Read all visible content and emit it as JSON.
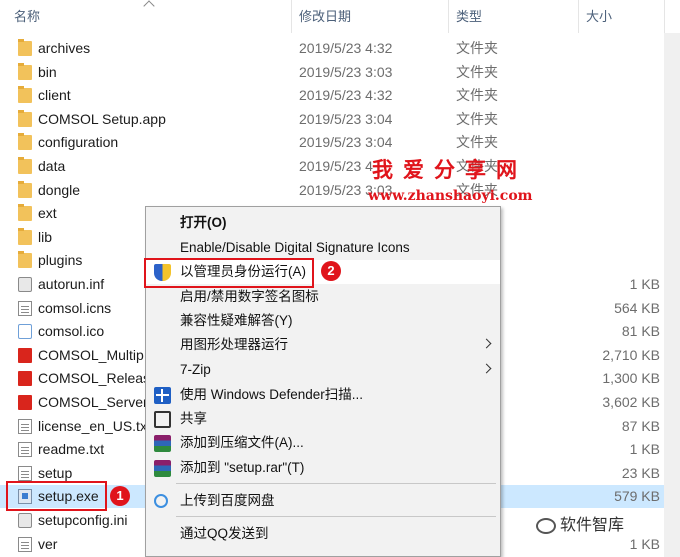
{
  "header": {
    "name": "名称",
    "date": "修改日期",
    "type": "类型",
    "size": "大小"
  },
  "files": [
    {
      "name": "archives",
      "date": "2019/5/23 4:32",
      "type": "文件夹",
      "size": "",
      "icon": "folder-icon"
    },
    {
      "name": "bin",
      "date": "2019/5/23 3:03",
      "type": "文件夹",
      "size": "",
      "icon": "folder-icon"
    },
    {
      "name": "client",
      "date": "2019/5/23 4:32",
      "type": "文件夹",
      "size": "",
      "icon": "folder-icon"
    },
    {
      "name": "COMSOL Setup.app",
      "date": "2019/5/23 3:04",
      "type": "文件夹",
      "size": "",
      "icon": "folder-icon"
    },
    {
      "name": "configuration",
      "date": "2019/5/23 3:04",
      "type": "文件夹",
      "size": "",
      "icon": "folder-icon"
    },
    {
      "name": "data",
      "date": "2019/5/23 4",
      "type": "文件夹",
      "size": "",
      "icon": "folder-icon"
    },
    {
      "name": "dongle",
      "date": "2019/5/23 3:03",
      "type": "文件夹",
      "size": "",
      "icon": "folder-icon"
    },
    {
      "name": "ext",
      "date": "",
      "type": "",
      "size": "",
      "icon": "folder-icon"
    },
    {
      "name": "lib",
      "date": "",
      "type": "",
      "size": "",
      "icon": "folder-icon"
    },
    {
      "name": "plugins",
      "date": "",
      "type": "",
      "size": "",
      "icon": "folder-icon"
    },
    {
      "name": "autorun.inf",
      "date": "",
      "type": "息",
      "size": "1 KB",
      "icon": "settings-file-icon"
    },
    {
      "name": "comsol.icns",
      "date": "",
      "type": "件",
      "size": "564 KB",
      "icon": "document-icon"
    },
    {
      "name": "comsol.ico",
      "date": "",
      "type": "",
      "size": "81 KB",
      "icon": "ico-file-icon"
    },
    {
      "name": "COMSOL_Multip",
      "date": "",
      "type": "件",
      "size": "2,710 KB",
      "icon": "pdf-icon"
    },
    {
      "name": "COMSOL_Releas",
      "date": "",
      "type": "件",
      "size": "1,300 KB",
      "icon": "pdf-icon"
    },
    {
      "name": "COMSOL_Server",
      "date": "",
      "type": "件",
      "size": "3,602 KB",
      "icon": "pdf-icon"
    },
    {
      "name": "license_en_US.tx",
      "date": "",
      "type": "",
      "size": "87 KB",
      "icon": "document-icon"
    },
    {
      "name": "readme.txt",
      "date": "",
      "type": "档",
      "size": "1 KB",
      "icon": "document-icon"
    },
    {
      "name": "setup",
      "date": "",
      "type": "",
      "size": "23 KB",
      "icon": "document-icon"
    },
    {
      "name": "setup.exe",
      "date": "",
      "type": "序",
      "size": "579 KB",
      "icon": "exe-icon",
      "selected": true
    },
    {
      "name": "setupconfig.ini",
      "date": "",
      "type": "置",
      "size": "",
      "icon": "settings-file-icon"
    },
    {
      "name": "ver",
      "date": "",
      "type": "",
      "size": "1 KB",
      "icon": "document-icon"
    }
  ],
  "watermark": {
    "title": "我爱分享网",
    "url": "www.zhanshaoyi.com"
  },
  "menu": {
    "items": [
      {
        "label": "打开(O)",
        "bold": true,
        "icon": "",
        "submenu": false
      },
      {
        "label": "Enable/Disable Digital Signature Icons",
        "icon": "",
        "submenu": false
      },
      {
        "label": "以管理员身份运行(A)",
        "icon": "uac-shield-icon",
        "submenu": false,
        "hover": true
      },
      {
        "label": "启用/禁用数字签名图标",
        "icon": "",
        "submenu": false
      },
      {
        "label": "兼容性疑难解答(Y)",
        "icon": "",
        "submenu": false
      },
      {
        "label": "用图形处理器运行",
        "icon": "",
        "submenu": true
      },
      {
        "label": "7-Zip",
        "icon": "",
        "submenu": true
      },
      {
        "label": "使用 Windows Defender扫描...",
        "icon": "defender-icon",
        "submenu": false
      },
      {
        "label": "共享",
        "icon": "share-icon",
        "submenu": false
      },
      {
        "label": "添加到压缩文件(A)...",
        "icon": "winrar-icon",
        "submenu": false
      },
      {
        "label": "添加到 \"setup.rar\"(T)",
        "icon": "winrar-icon",
        "submenu": false
      },
      {
        "label": "上传到百度网盘",
        "icon": "baidu-netdisk-icon",
        "submenu": false
      },
      {
        "label": "通过QQ发送到",
        "icon": "",
        "submenu": false
      }
    ]
  },
  "annotations": {
    "badge1": "1",
    "badge2": "2"
  },
  "brand": {
    "text": "软件智库"
  },
  "colors": {
    "accent_red": "#e0141b",
    "selection": "#cce8ff",
    "folder": "#f2c25b"
  }
}
